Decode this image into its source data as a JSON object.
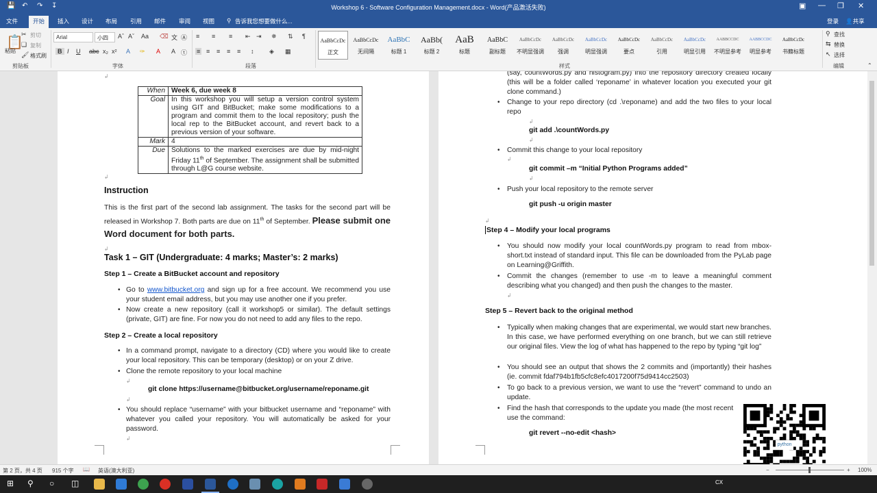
{
  "window": {
    "title": "Workshop 6 - Software Configuration Management.docx - Word(产品激活失败)",
    "sign_in": "登录",
    "share": "共享"
  },
  "tabs": [
    "文件",
    "开始",
    "插入",
    "设计",
    "布局",
    "引用",
    "邮件",
    "审阅",
    "视图"
  ],
  "tell_me": "告诉我您想要做什么...",
  "ribbon": {
    "clipboard": {
      "paste": "粘贴",
      "cut": "剪切",
      "copy": "复制",
      "format_painter": "格式刷",
      "label": "剪贴板"
    },
    "font": {
      "name": "Arial",
      "size": "小四",
      "label": "字体"
    },
    "paragraph": {
      "label": "段落"
    },
    "styles": {
      "label": "样式",
      "items": [
        {
          "preview": "AaBbCcDc",
          "name": "正文"
        },
        {
          "preview": "AaBbCcDc",
          "name": "无间隔"
        },
        {
          "preview": "AaBbC",
          "name": "标题 1"
        },
        {
          "preview": "AaBb(",
          "name": "标题 2"
        },
        {
          "preview": "AaB",
          "name": "标题"
        },
        {
          "preview": "AaBbC",
          "name": "副标题"
        },
        {
          "preview": "AaBbCcDc",
          "name": "不明显强调"
        },
        {
          "preview": "AaBbCcDc",
          "name": "强调"
        },
        {
          "preview": "AaBbCcDc",
          "name": "明显强调"
        },
        {
          "preview": "AaBbCcDc",
          "name": "要点"
        },
        {
          "preview": "AaBbCcDc",
          "name": "引用"
        },
        {
          "preview": "AaBbCcDc",
          "name": "明显引用"
        },
        {
          "preview": "AABBCCDC",
          "name": "不明显参考"
        },
        {
          "preview": "AABBCCDC",
          "name": "明显参考"
        },
        {
          "preview": "AaBbCcDc",
          "name": "书籍标题"
        }
      ]
    },
    "editing": {
      "find": "查找",
      "replace": "替换",
      "select": "选择",
      "label": "编辑"
    }
  },
  "table": [
    {
      "key": "When",
      "value": "Week 6, due week 8"
    },
    {
      "key": "Goal",
      "value": "In this workshop you will setup a version control system using GIT and BitBucket; make some modifications to a program and commit them to the local repository; push the local rep to the BitBucket account, and revert back to a previous version of your software."
    },
    {
      "key": "Mark",
      "value": "4"
    },
    {
      "key": "Due",
      "value_a": "Solutions to the marked exercises are due by mid-night Friday 11",
      "value_sup": "th",
      "value_b": " of September. The assignment shall be submitted through L@G course website."
    }
  ],
  "left": {
    "instruction_heading": "Instruction",
    "instruction_a": "This is the first part of the second lab assignment. The tasks for the second part will be released in Workshop 7. Both parts are due on 11",
    "instruction_sup": "th",
    "instruction_b": " of September. ",
    "instruction_big": "Please submit one Word document for both parts.",
    "task1": "Task 1 – GIT (Undergraduate: 4 marks; Master’s: 2 marks)",
    "step1": "Step 1 – Create a BitBucket account and repository",
    "s1_b1_a": "Go to ",
    "s1_b1_link": "www.bitbucket.org",
    "s1_b1_b": " and sign up for a free account. We recommend you use your student email address, but you may use another one if you prefer.",
    "s1_b2": "Now create a new repository (call it workshop5 or similar). The default settings (private, GIT) are fine. For now you do not need to add any files to the repo.",
    "step2": "Step 2 – Create a local repository",
    "s2_b1": "In a command prompt, navigate to a directory (CD) where you would like to create your local repository. This can be temporary (desktop) or on your Z drive.",
    "s2_b2": "Clone the remote repository to your local machine",
    "s2_cmd": "git clone https://username@bitbucket.org/username/reponame.git",
    "s2_b3": "You should replace “username” with your bitbucket username and “reponame” with whatever you called your repository. You will automatically be asked for your password."
  },
  "right": {
    "cont": "(say, countWords.py and histogram.py) into the repository directory created locally (this will be a folder called ‘reponame’ in whatever location you executed your git clone command.)",
    "b_cd": "Change to your repo directory (cd .\\reponame) and add the two files to your local repo",
    "cmd_add": "git add .\\countWords.py",
    "b_commit": "Commit this change to your local repository",
    "cmd_commit": "git commit –m “Initial Python Programs added”",
    "b_push": "Push your local repository to the remote server",
    "cmd_push": "git push -u origin master",
    "step4": "Step 4 – Modify your local programs",
    "s4_b1": "You should now modify your local countWords.py program to read from mbox-short.txt instead of standard input. This file can be downloaded from the PyLab page on Learning@Griffith.",
    "s4_b2": "Commit the changes (remember to use -m to leave a meaningful comment describing what you changed) and then push the changes to the master.",
    "step5": "Step 5 – Revert back to the original method",
    "s5_b1": "Typically when making changes that are experimental, we would start new branches. In this case, we have performed everything on one branch, but we can still retrieve our original files. View the log of what has happened to the repo by typing “git log”",
    "s5_b2": "You should see an output that shows the 2 commits and (importantly) their hashes (ie. commit fdaf794b1fb5cfc8efc4017200f75d9414cc2503)",
    "s5_b3": "To go back to a previous version, we want to use the “revert” command to undo an update.",
    "s5_b4": "Find the hash that corresponds to the update you made (the most recent use the command:",
    "cmd_revert": "git revert --no-edit <hash>"
  },
  "status": {
    "page": "第 2 页，共 4 页",
    "words": "915 个字",
    "lang": "英语(澳大利亚)",
    "zoom": "100%"
  },
  "tray": {
    "ime": "CX"
  },
  "qr": {
    "logo": "python"
  }
}
